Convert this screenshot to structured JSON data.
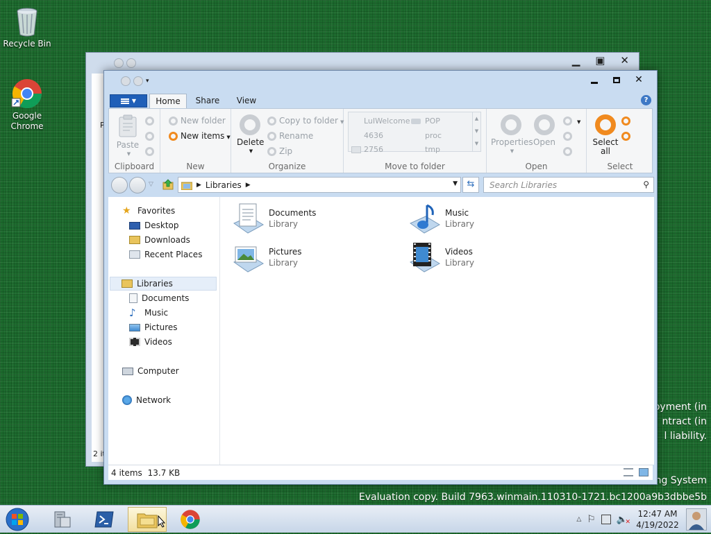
{
  "desktop": {
    "icons": [
      {
        "label": "Recycle Bin",
        "icon": "recycle-bin-icon"
      },
      {
        "label": "Google Chrome",
        "icon": "chrome-icon"
      }
    ],
    "watermark": {
      "line1": "oyment (in",
      "line2": "ntract (in",
      "line3": "l liability.",
      "line4": "ng System",
      "line5": "Evaluation copy. Build 7963.winmain.110310-1721.bc1200a9b3dbbe5b"
    }
  },
  "window": {
    "title_buttons": {
      "minimize": "minimize",
      "maximize": "maximize",
      "close": "✕"
    },
    "tabs": [
      {
        "label": "Home",
        "active": true
      },
      {
        "label": "Share",
        "active": false
      },
      {
        "label": "View",
        "active": false
      }
    ],
    "ribbon": {
      "clipboard": {
        "label": "Clipboard",
        "paste": "Paste"
      },
      "new": {
        "label": "New",
        "new_folder": "New folder",
        "new_items": "New items"
      },
      "organize": {
        "label": "Organize",
        "delete": "Delete",
        "copy_to_folder": "Copy to folder",
        "rename": "Rename",
        "zip": "Zip"
      },
      "move_to_folder": {
        "label": "Move to folder",
        "items": [
          "LuIWelcome",
          "POP",
          "4636",
          "proc",
          "2756",
          "tmp"
        ]
      },
      "open": {
        "label": "Open",
        "properties": "Properties",
        "open": "Open"
      },
      "select": {
        "label": "Select",
        "select_all_line1": "Select",
        "select_all_line2": "all"
      }
    },
    "address": {
      "crumb": "Libraries",
      "search_placeholder": "Search Libraries"
    },
    "nav_pane": {
      "favorites": "Favorites",
      "favorites_items": [
        "Desktop",
        "Downloads",
        "Recent Places"
      ],
      "libraries": "Libraries",
      "libraries_items": [
        "Documents",
        "Music",
        "Pictures",
        "Videos"
      ],
      "computer": "Computer",
      "network": "Network"
    },
    "libraries": [
      {
        "name": "Documents",
        "type": "Library"
      },
      {
        "name": "Music",
        "type": "Library"
      },
      {
        "name": "Pictures",
        "type": "Library"
      },
      {
        "name": "Videos",
        "type": "Library"
      }
    ],
    "status": {
      "count": "4 items",
      "size": "13.7 KB"
    }
  },
  "back_window": {
    "status_fragment": "2 it",
    "ribbon_fragment": "P"
  },
  "taskbar": {
    "clock_time": "12:47 AM",
    "clock_date": "4/19/2022"
  },
  "colors": {
    "accent_blue": "#1f5fb8",
    "orange": "#f08a1f",
    "desktop_green": "#1d6b2e"
  }
}
